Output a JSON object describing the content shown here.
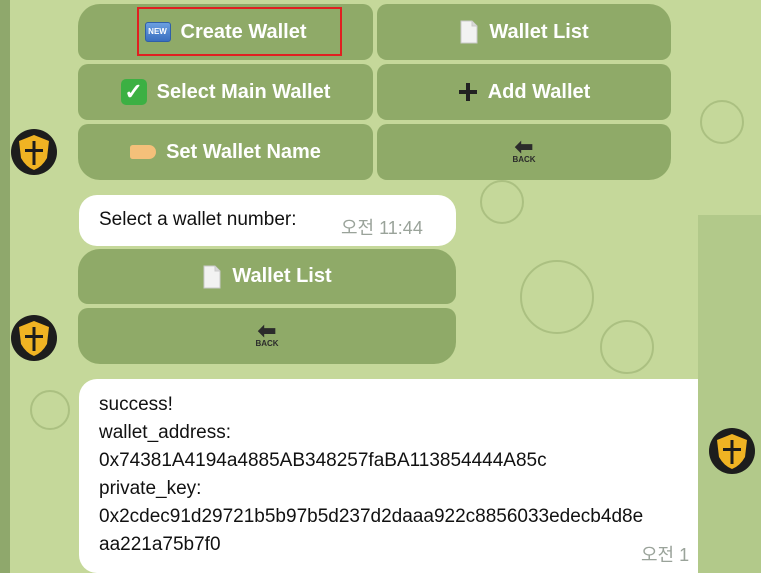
{
  "keyboard1": {
    "create_wallet": "Create Wallet",
    "new_icon_text": "NEW",
    "wallet_list": "Wallet List",
    "select_main_wallet": "Select Main Wallet",
    "add_wallet": "Add Wallet",
    "set_wallet_name": "Set Wallet Name",
    "back_text": "BACK"
  },
  "message1": {
    "text": "Select a wallet number:",
    "time": "오전 11:44"
  },
  "keyboard2": {
    "wallet_list": "Wallet List",
    "back_text": "BACK"
  },
  "message2": {
    "line1": "success!",
    "line2": "wallet_address:",
    "line3": "0x74381A4194a4885AB348257faBA113854444A85c",
    "line4": "private_key:",
    "line5": "0x2cdec91d29721b5b97b5d237d2daaa922c8856033edecb4d8e",
    "line6": "aa221a75b7f0",
    "time": "오전 1"
  },
  "colors": {
    "accent_highlight": "#e02020",
    "button_bg": "#8faa68",
    "chat_bg": "#c5d89a"
  }
}
